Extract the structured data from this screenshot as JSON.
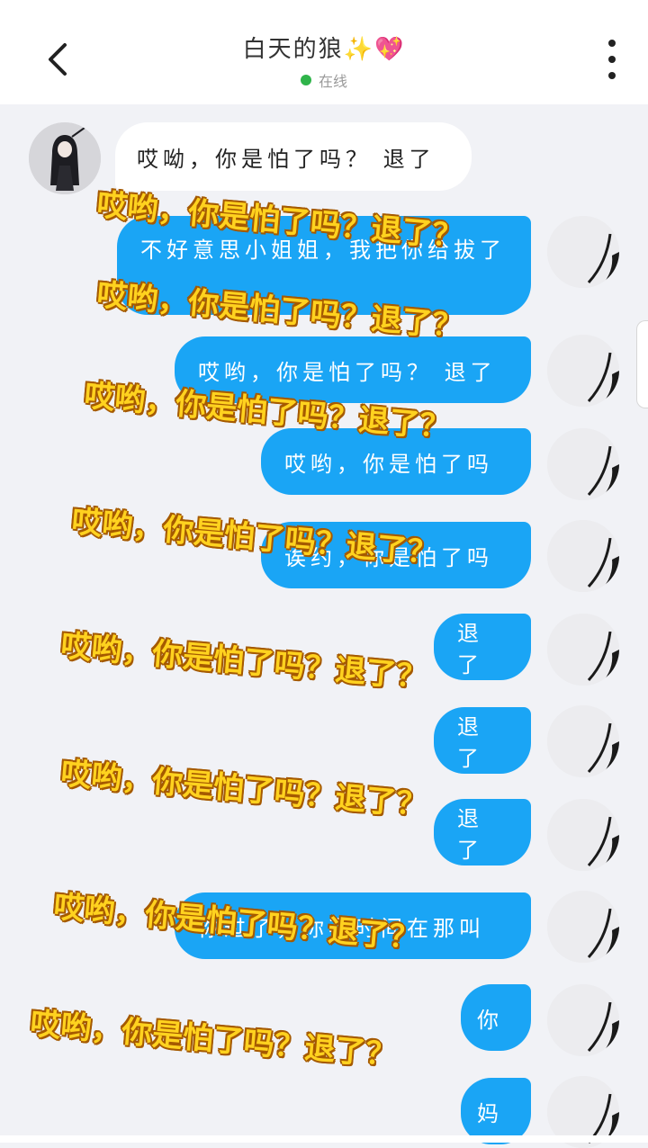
{
  "header": {
    "title": "白天的狼",
    "title_emoji_spark": "✨",
    "title_emoji_heart": "💖",
    "status": "在线"
  },
  "messages": [
    {
      "side": "in",
      "text": "哎呦，你是怕了吗？ 退了"
    },
    {
      "side": "out",
      "text": "不好意思小姐姐，我把你给拔了"
    },
    {
      "side": "out",
      "text": "哎哟，你是怕了吗？ 退了"
    },
    {
      "side": "out",
      "text": "哎哟，你是怕了吗"
    },
    {
      "side": "out",
      "text": "诶约，你是怕了吗"
    },
    {
      "side": "out",
      "text": "退了"
    },
    {
      "side": "out",
      "text": "退了"
    },
    {
      "side": "out",
      "text": "退了"
    },
    {
      "side": "out",
      "text": "你过了，你我时间在那叫"
    },
    {
      "side": "out",
      "text": "你"
    },
    {
      "side": "out",
      "text": "妈"
    }
  ],
  "overlay_caption": "哎哟，你是怕了吗？退了？",
  "colors": {
    "accent_blue": "#1aa5f5",
    "online_green": "#2fb44a",
    "caption_yellow": "#ffd21f"
  },
  "icons": [
    "back-arrow-icon",
    "more-vertical-icon",
    "online-dot-icon"
  ]
}
